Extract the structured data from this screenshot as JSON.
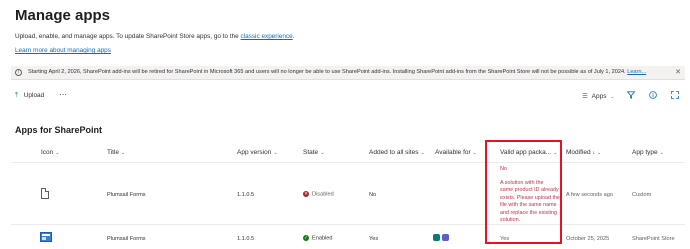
{
  "page": {
    "title": "Manage apps",
    "description": "Upload, enable, and manage apps. To update SharePoint Store apps, go to the ",
    "description_link": "classic experience",
    "description_end": ".",
    "learn_more": "Learn more about managing apps"
  },
  "banner": {
    "icon": "info-icon",
    "text": "Starting April 2, 2026, SharePoint add-ins will be retired for SharePoint in Microsoft 365 and users will no longer be able to use SharePoint add-ins. Installing SharePoint add-ins from the SharePoint Store will not be possible as of July 1, 2024.",
    "link": "Learn...",
    "close_icon": "close-icon"
  },
  "toolbar": {
    "upload_icon": "upload-icon",
    "upload_label": "Upload",
    "more_icon": "more-icon",
    "view_label": "Apps",
    "view_icon": "list-icon",
    "filter_icon": "filter-icon",
    "info_icon": "info-icon",
    "fullscreen_icon": "fullscreen-icon"
  },
  "section_title": "Apps for SharePoint",
  "columns": {
    "icon": "Icon",
    "title": "Title",
    "app_version": "App version",
    "state": "State",
    "added_to_all_sites": "Added to all sites",
    "available_for": "Available for",
    "valid_app_package": "Valid app packa...",
    "modified": "Modified",
    "modified_sort": "↓",
    "app_type": "App type"
  },
  "rows": [
    {
      "title": "Plumsail Forms",
      "app_version": "1.1.0.5",
      "state": "Disabled",
      "state_color": "#a4262c",
      "added_to_all_sites": "No",
      "available_for": "",
      "valid_value": "No",
      "valid_error": [
        "A solution with the",
        "same product ID already",
        "exists. Please upload the",
        "file with the same name",
        "and replace the existing",
        "solution."
      ],
      "modified": "A few seconds ago",
      "app_type": "Custom"
    },
    {
      "title": "Plumsail Forms",
      "app_version": "1.1.0.5",
      "state": "Enabled",
      "state_color": "#107c10",
      "added_to_all_sites": "Yes",
      "available_for_icons": [
        "teams-icon",
        "sharepoint-icon"
      ],
      "valid_value": "Yes",
      "modified": "October 25, 2025",
      "app_type": "SharePoint Store"
    }
  ],
  "colors": {
    "accent": "#0f6cbd",
    "highlight_border": "#e81123",
    "error_text": "#c4314b"
  }
}
